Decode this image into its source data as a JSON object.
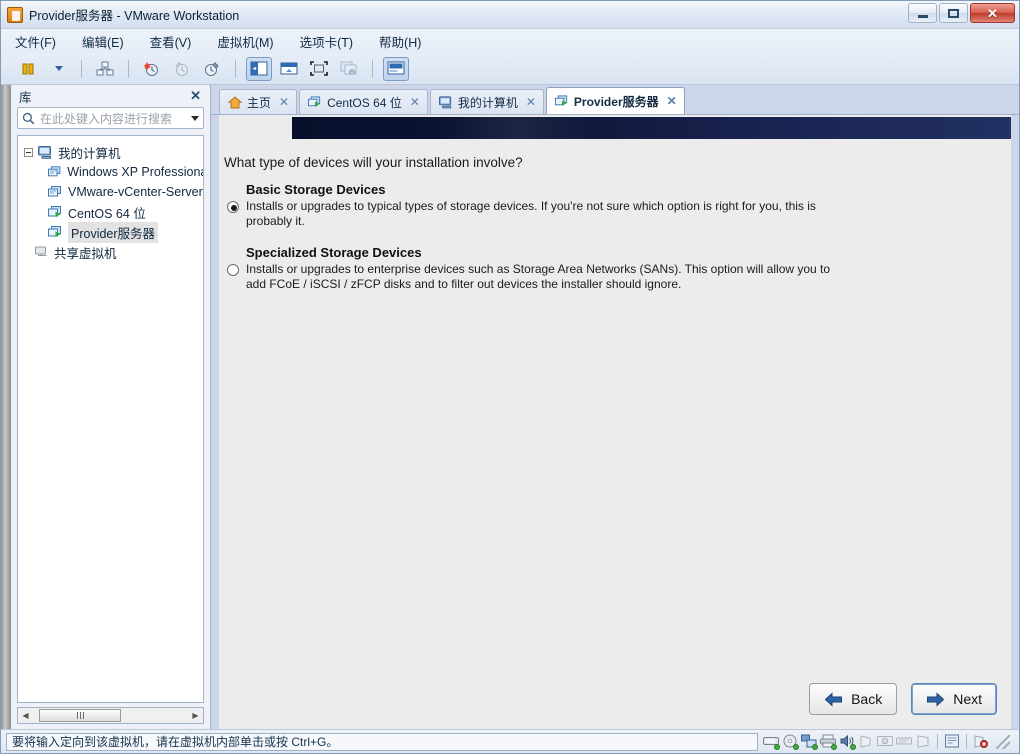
{
  "window": {
    "title": "Provider服务器 - VMware Workstation",
    "app_icon": "vmware-icon",
    "controls": {
      "minimize": "minimize-icon",
      "restore": "restore-icon",
      "close": "close-icon"
    }
  },
  "menu": {
    "items": [
      {
        "label": "文件(F)",
        "name": "menu-file"
      },
      {
        "label": "编辑(E)",
        "name": "menu-edit"
      },
      {
        "label": "查看(V)",
        "name": "menu-view"
      },
      {
        "label": "虚拟机(M)",
        "name": "menu-vm"
      },
      {
        "label": "选项卡(T)",
        "name": "menu-tabs"
      },
      {
        "label": "帮助(H)",
        "name": "menu-help"
      }
    ]
  },
  "toolbar": {
    "buttons": [
      {
        "name": "power-suspend-button",
        "icon": "pause-icon"
      },
      {
        "name": "power-dropdown-button",
        "icon": "chevron-down-icon"
      },
      {
        "name": "snapshot-manager-button",
        "icon": "snapshot-manager-icon"
      },
      {
        "name": "take-snapshot-button",
        "icon": "take-snapshot-icon"
      },
      {
        "name": "revert-snapshot-button",
        "icon": "revert-snapshot-icon"
      },
      {
        "name": "manage-snapshots-button",
        "icon": "snapshot-settings-icon"
      },
      {
        "name": "show-library-button",
        "icon": "sidebar-toggle-icon"
      },
      {
        "name": "show-thumbnails-button",
        "icon": "thumbnail-bar-icon"
      },
      {
        "name": "full-screen-button",
        "icon": "fullscreen-icon"
      },
      {
        "name": "unity-mode-button",
        "icon": "unity-icon"
      },
      {
        "name": "console-view-button",
        "icon": "console-view-icon"
      }
    ]
  },
  "sidebar": {
    "header": "库",
    "close_icon": "close-icon",
    "search": {
      "placeholder": "在此处键入内容进行搜索",
      "value": "",
      "icon": "search-icon",
      "dropdown_icon": "chevron-down-icon"
    },
    "tree": {
      "root": {
        "label": "我的计算机",
        "icon": "my-computer-icon",
        "expanded": true
      },
      "items": [
        {
          "label": "Windows XP Professional",
          "icon": "vm-icon",
          "running": false
        },
        {
          "label": "VMware-vCenter-Server",
          "icon": "vm-icon",
          "running": false
        },
        {
          "label": "CentOS 64 位",
          "icon": "vm-running-icon",
          "running": true
        },
        {
          "label": "Provider服务器",
          "icon": "vm-running-icon",
          "running": true,
          "selected": true
        }
      ],
      "shared": {
        "label": "共享虚拟机",
        "icon": "shared-vm-icon"
      }
    },
    "scrollbar": {
      "left_icon": "arrow-left-icon",
      "right_icon": "arrow-right-icon"
    }
  },
  "tabs": [
    {
      "label": "主页",
      "icon": "home-icon",
      "active": false,
      "close_icon": "close-icon"
    },
    {
      "label": "CentOS 64 位",
      "icon": "vm-running-icon",
      "active": false,
      "close_icon": "close-icon"
    },
    {
      "label": "我的计算机",
      "icon": "my-computer-icon",
      "active": false,
      "close_icon": "close-icon"
    },
    {
      "label": "Provider服务器",
      "icon": "vm-running-icon",
      "active": true,
      "close_icon": "close-icon"
    }
  ],
  "installer": {
    "question": "What type of devices will your installation involve?",
    "options": [
      {
        "title": "Basic Storage Devices",
        "description": "Installs or upgrades to typical types of storage devices.  If you're not sure which option is right for you, this is probably it.",
        "selected": true
      },
      {
        "title": "Specialized Storage Devices",
        "description": "Installs or upgrades to enterprise devices such as Storage Area Networks (SANs). This option will allow you to add FCoE / iSCSI / zFCP disks and to filter out devices the installer should ignore.",
        "selected": false
      }
    ],
    "buttons": {
      "back": {
        "label": "Back",
        "icon": "arrow-left-icon"
      },
      "next": {
        "label": "Next",
        "icon": "arrow-right-icon",
        "focused": true
      }
    },
    "banner_color_start": "#080f2b",
    "banner_color_end": "#223063"
  },
  "statusbar": {
    "message": "要将输入定向到该虚拟机，请在虚拟机内部单击或按 Ctrl+G。",
    "devices": [
      {
        "name": "hard-disk-icon",
        "connected": true
      },
      {
        "name": "cd-dvd-icon",
        "connected": true
      },
      {
        "name": "network-adapter-icon",
        "connected": true
      },
      {
        "name": "printer-icon",
        "connected": true
      },
      {
        "name": "sound-card-icon",
        "connected": true
      },
      {
        "name": "usb-icon",
        "connected": false
      },
      {
        "name": "camera-icon",
        "connected": false
      },
      {
        "name": "keyboard-icon",
        "connected": false
      },
      {
        "name": "display-icon",
        "connected": false
      }
    ],
    "message_icon": "message-log-icon",
    "alert_icon": "alert-icon"
  },
  "colors": {
    "accent": "#2f5f9e",
    "tab_strip": "#ccd5ea",
    "vm_screen": "#ececec"
  }
}
